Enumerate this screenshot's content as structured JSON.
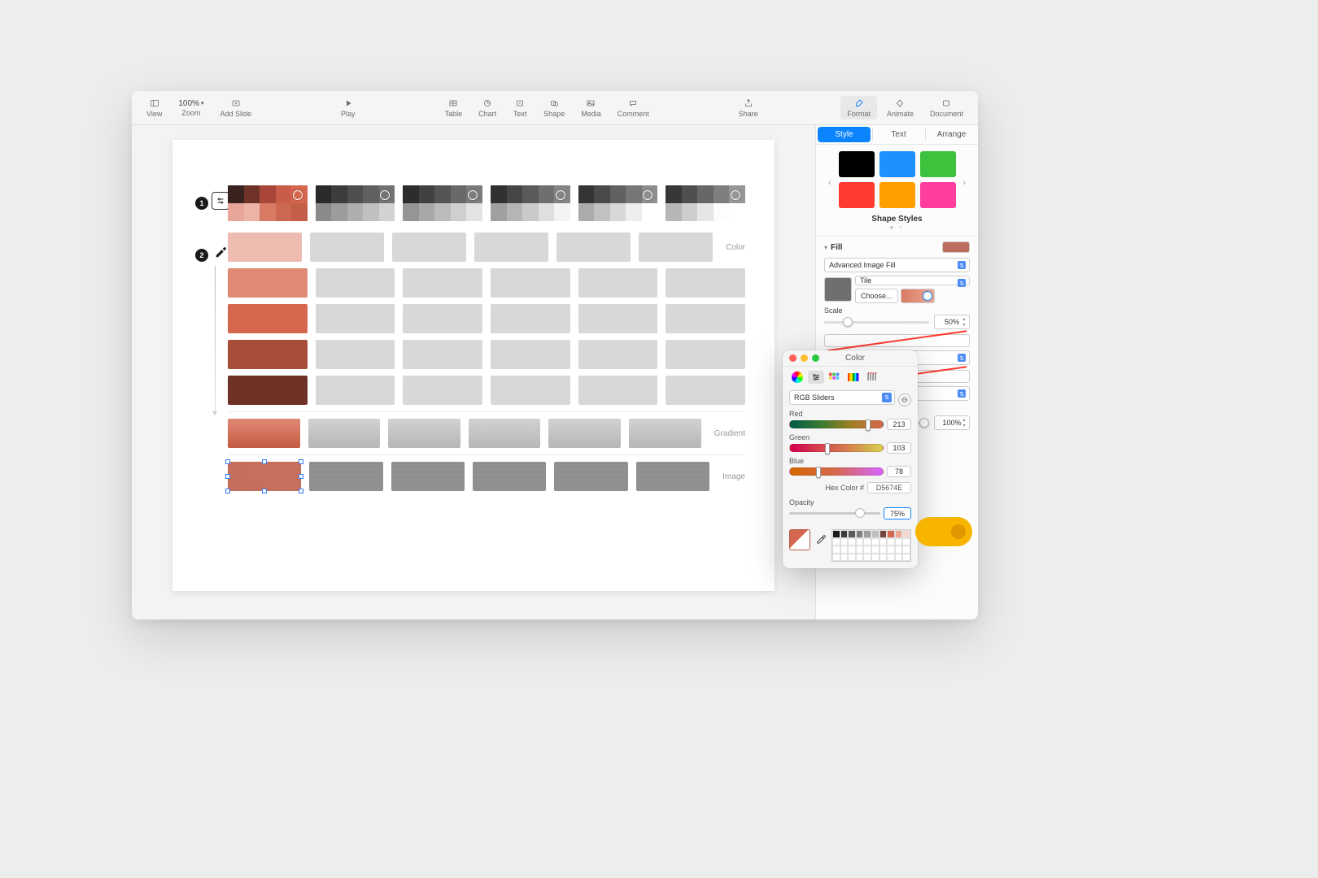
{
  "toolbar": {
    "view": "View",
    "zoom_label": "Zoom",
    "zoom_value": "100%",
    "add_slide": "Add Slide",
    "play": "Play",
    "table": "Table",
    "chart": "Chart",
    "text": "Text",
    "shape": "Shape",
    "media": "Media",
    "comment": "Comment",
    "share": "Share",
    "format": "Format",
    "animate": "Animate",
    "document": "Document"
  },
  "inspector": {
    "tabs": {
      "style": "Style",
      "text": "Text",
      "arrange": "Arrange"
    },
    "shape_styles_label": "Shape Styles",
    "style_swatches": [
      "#000000",
      "#1e90ff",
      "#3cc23c",
      "#ff3b30",
      "#ffa000",
      "#ff3d9d"
    ],
    "fill": {
      "title": "Fill",
      "chip_color": "#bd6e5e",
      "type": "Advanced Image Fill",
      "tile": "Tile",
      "choose": "Choose...",
      "scale_label": "Scale",
      "scale_value": "50%",
      "opacity_label": "Opacity",
      "opacity_value": "100%"
    }
  },
  "color_panel": {
    "title": "Color",
    "mode": "RGB Sliders",
    "red_label": "Red",
    "red_value": "213",
    "green_label": "Green",
    "green_value": "103",
    "blue_label": "Blue",
    "blue_value": "78",
    "hex_label": "Hex Color #",
    "hex_value": "D5674E",
    "opacity_label": "Opacity",
    "opacity_value": "75%",
    "current_color": "#d5674e",
    "mini_swatches_row1": [
      "#1a1a1a",
      "#3a3a3a",
      "#5b5b5b",
      "#7d7d7d",
      "#9e9e9e",
      "#bfbfbf",
      "#72463a",
      "#d5674e",
      "#eaa892",
      "#f4d7cf"
    ]
  },
  "slide": {
    "step1": "1",
    "step2": "2",
    "row_labels": {
      "color": "Color",
      "gradient": "Gradient",
      "image": "Image"
    },
    "palette_first": {
      "top": [
        "#3a231e",
        "#70332a",
        "#a9463a",
        "#c95d4a",
        "#d5674e"
      ],
      "bot": [
        "#e8a598",
        "#ecb3a7",
        "#d87a64",
        "#cc6852",
        "#c45e48"
      ]
    },
    "palette_grey_dark": [
      "#2a2a2a",
      "#3c3c3c",
      "#4e4e4e",
      "#606060",
      "#727272"
    ],
    "palette_grey_light": [
      "#8a8a8a",
      "#9c9c9c",
      "#aeaeae",
      "#c0c0c0",
      "#d2d2d2"
    ],
    "color_column": [
      "#eebbb1",
      "#e08974",
      "#d5674e",
      "#a84d39",
      "#6e3226"
    ],
    "grey_placeholder": "#d6d8da",
    "gradient_first": "linear-gradient(180deg,#e08974,#c45a44)",
    "gradient_grey": "linear-gradient(180deg,#d0d2d4,#b4b6b8)",
    "image_first": "#c46b58",
    "image_grey": "#8c8d8e"
  }
}
